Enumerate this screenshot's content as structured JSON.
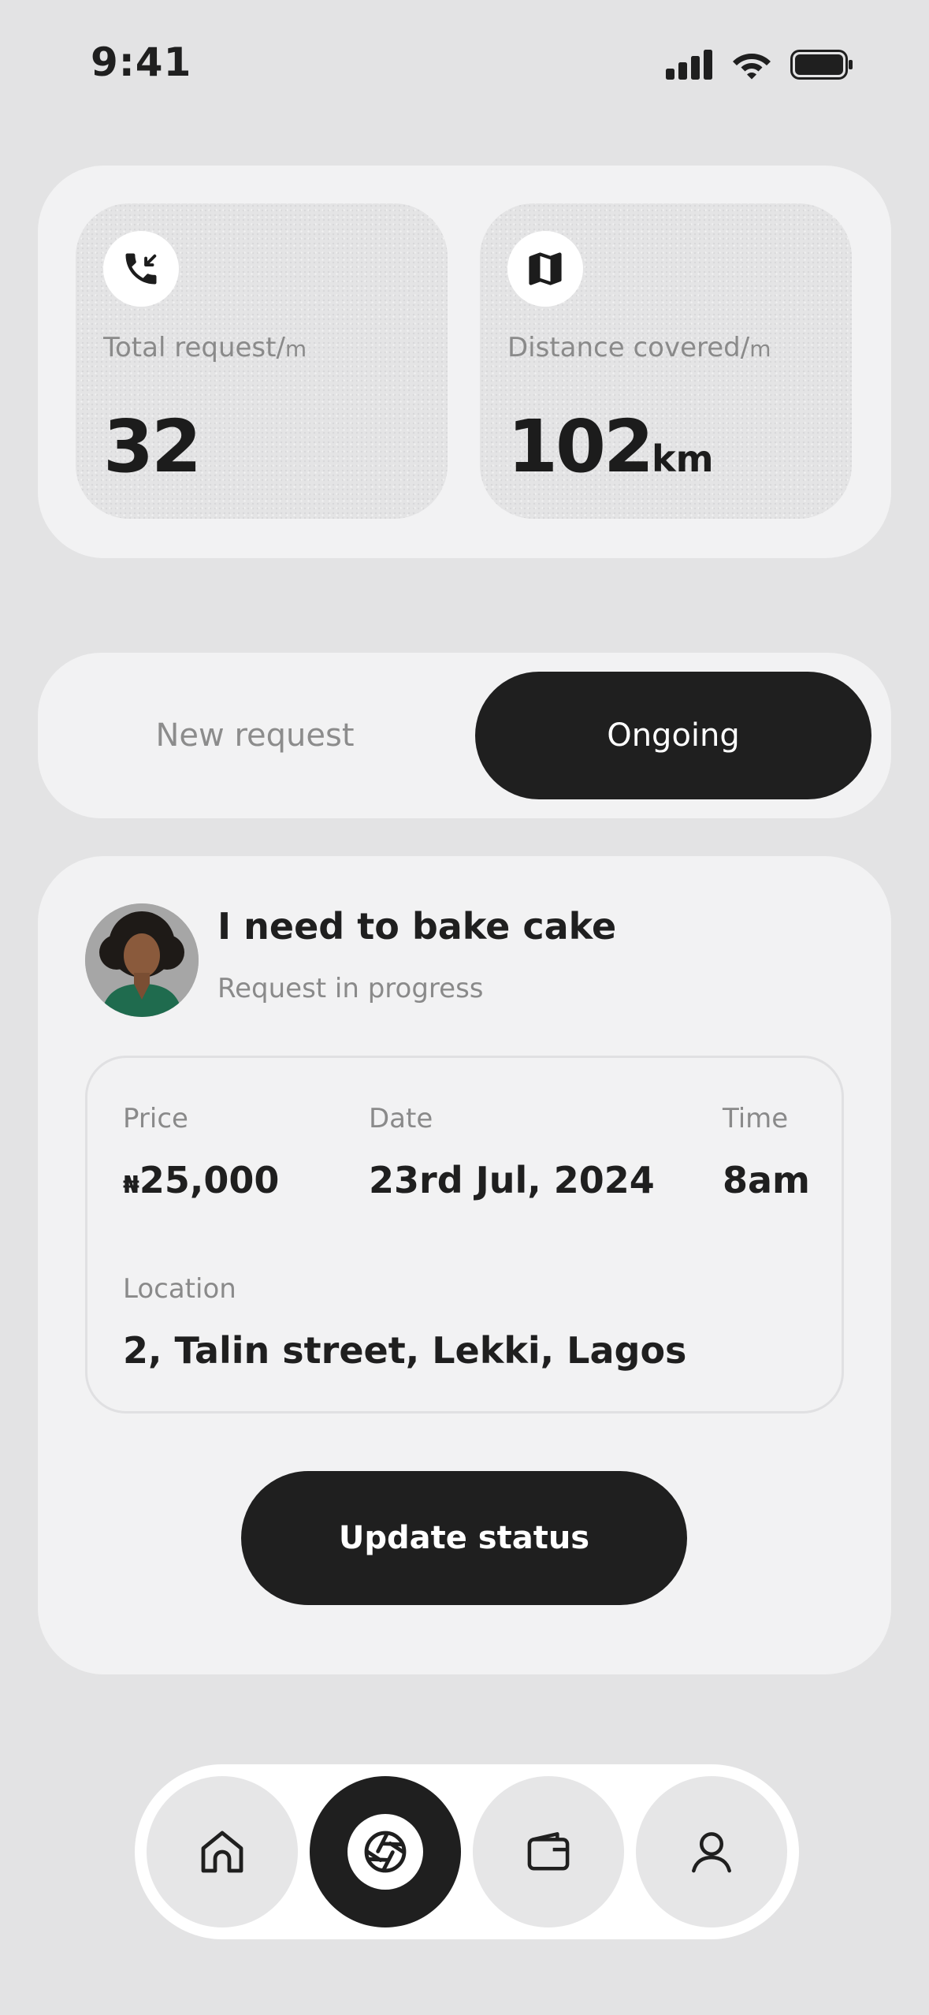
{
  "status_bar": {
    "time": "9:41",
    "icons": [
      "cellular-signal-icon",
      "wifi-icon",
      "battery-icon"
    ]
  },
  "stats": [
    {
      "icon": "incoming-call-icon",
      "label": "Total request/",
      "label_unit": "m",
      "value": "32",
      "value_unit": ""
    },
    {
      "icon": "map-icon",
      "label": "Distance covered/",
      "label_unit": "m",
      "value": "102",
      "value_unit": "km"
    }
  ],
  "tabs": {
    "new_request": "New request",
    "ongoing": "Ongoing",
    "active": "ongoing"
  },
  "request": {
    "title": "I need to bake cake",
    "subtitle": "Request in progress",
    "price_label": "Price",
    "price_currency": "₦",
    "price_value": "25,000",
    "date_label": "Date",
    "date_value": "23rd Jul, 2024",
    "time_label": "Time",
    "time_value": "8am",
    "location_label": "Location",
    "location_value": "2, Talin street, Lekki, Lagos",
    "button_label": "Update status"
  },
  "bottom_nav": {
    "items": [
      {
        "icon": "home-icon",
        "active": false
      },
      {
        "icon": "aperture-icon",
        "active": true
      },
      {
        "icon": "wallet-icon",
        "active": false
      },
      {
        "icon": "user-icon",
        "active": false
      }
    ]
  },
  "colors": {
    "background": "#e3e3e4",
    "card": "#f2f2f3",
    "primary_dark": "#1f1f1f",
    "muted_text": "#8a8a8a",
    "white": "#ffffff"
  }
}
